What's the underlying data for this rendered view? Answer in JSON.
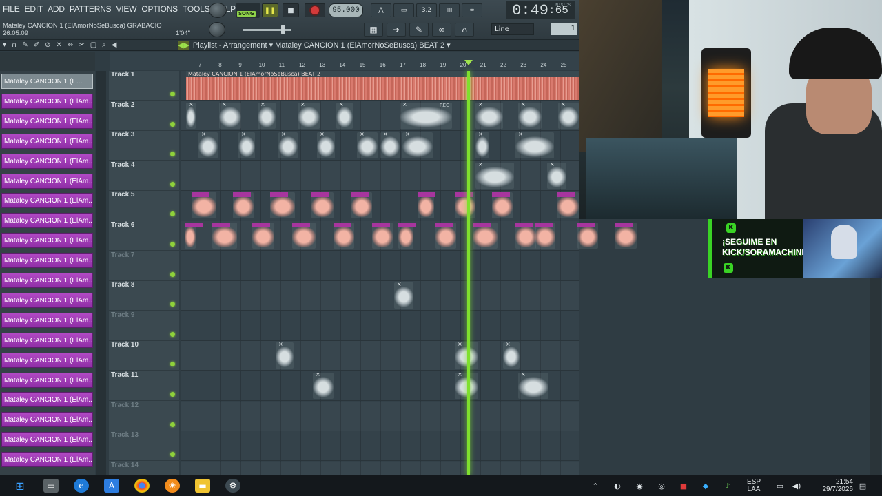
{
  "menu": [
    "FILE",
    "EDIT",
    "ADD",
    "PATTERNS",
    "VIEW",
    "OPTIONS",
    "TOOLS",
    "HELP"
  ],
  "transport": {
    "mode_label": "SONG",
    "tempo": "95.000",
    "time": "0:49",
    "time_frac": ":65",
    "time_unit": "M:S:CS",
    "snap": "Line",
    "pattern_num": "1"
  },
  "project": {
    "name": "Mataley CANCION 1 (ElAmorNoSeBusca) GRABACIO",
    "time": "26:05:09",
    "length": "1'04\""
  },
  "playlist": {
    "title": "Playlist - Arrangement",
    "pattern": "Mataley CANCION 1 (ElAmorNoSeBusca) BEAT 2",
    "ruler": [
      "7",
      "8",
      "9",
      "10",
      "11",
      "12",
      "13",
      "14",
      "15",
      "16",
      "17",
      "18",
      "19",
      "20",
      "21",
      "22",
      "23",
      "24",
      "25"
    ]
  },
  "channel_rack": {
    "items": [
      "Mataley CANCION 1 (E...",
      "Mataley CANCION 1 (ElAm...",
      "Mataley CANCION 1 (ElAm...",
      "Mataley CANCION 1 (ElAm...",
      "Mataley CANCION 1 (ElAm...",
      "Mataley CANCION 1 (ElAm...",
      "Mataley CANCION 1 (ElAm...",
      "Mataley CANCION 1 (ElAm...",
      "Mataley CANCION 1 (ElAm...",
      "Mataley CANCION 1 (ElAm...",
      "Mataley CANCION 1 (ElAm...",
      "Mataley CANCION 1 (ElAm...",
      "Mataley CANCION 1 (ElAm...",
      "Mataley CANCION 1 (ElAm...",
      "Mataley CANCION 1 (ElAm...",
      "Mataley CANCION 1 (ElAm...",
      "Mataley CANCION 1 (ElAm...",
      "Mataley CANCION 1 (ElAm...",
      "Mataley CANCION 1 (ElAm...",
      "Mataley CANCION 1 (ElAm..."
    ]
  },
  "tracks": [
    "Track 1",
    "Track 2",
    "Track 3",
    "Track 4",
    "Track 5",
    "Track 6",
    "Track 7",
    "Track 8",
    "Track 9",
    "Track 10",
    "Track 11",
    "Track 12",
    "Track 13",
    "Track 14"
  ],
  "beat_clip_label": "Mataley CANCION 1 (ElAmorNoSeBusca) BEAT 2",
  "rec_label": "REC",
  "promo": {
    "line1": "¡SEGUIME EN",
    "line2": "KICK/SORAMACHINE!"
  },
  "taskbar": {
    "lang": "ESP",
    "layout": "LAA",
    "clock": "21:54",
    "date": "29/7/2026"
  },
  "colors": {
    "accent_green": "#7fe02e",
    "clip_purple": "#a7359e",
    "rec_red": "#d43a3a",
    "kick_green": "#3ad325"
  },
  "icons": [
    "windows-start-icon",
    "task-view-icon",
    "edge-icon",
    "app-a-icon",
    "chrome-icon",
    "fl-studio-icon",
    "file-explorer-icon",
    "steam-icon"
  ]
}
